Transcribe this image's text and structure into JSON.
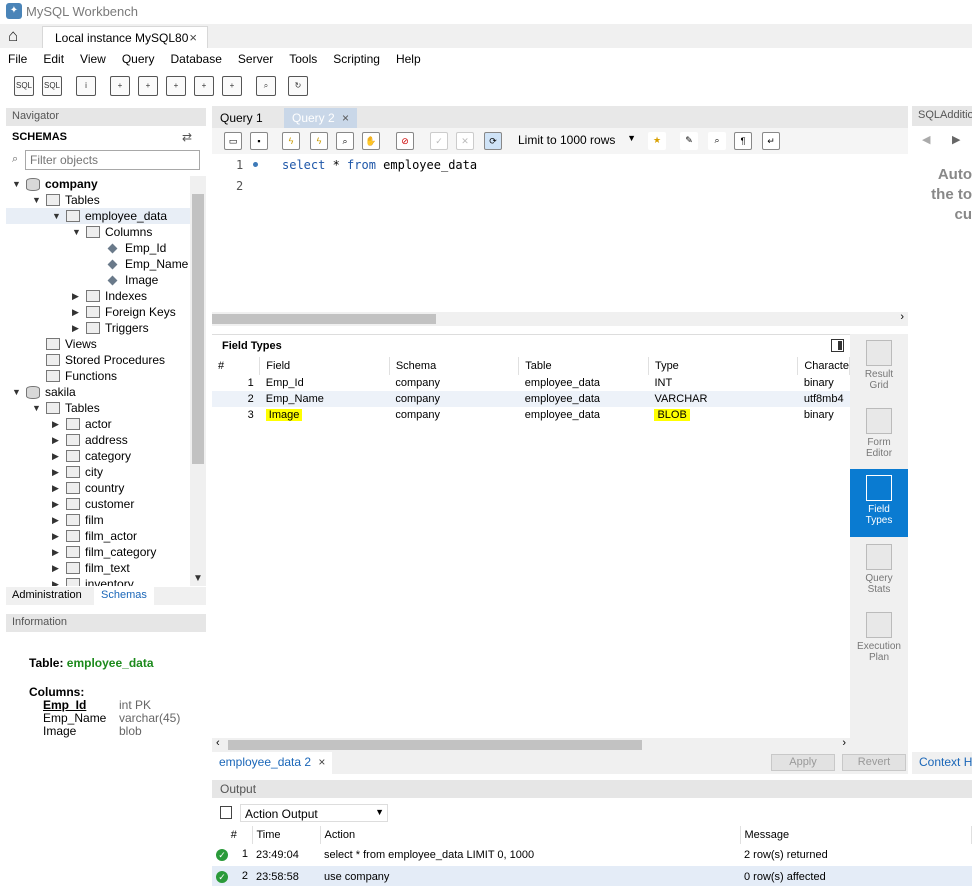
{
  "app": {
    "title": "MySQL Workbench"
  },
  "connection_tab": {
    "label": "Local instance MySQL80",
    "close": "×"
  },
  "menu": [
    "File",
    "Edit",
    "View",
    "Query",
    "Database",
    "Server",
    "Tools",
    "Scripting",
    "Help"
  ],
  "navigator": {
    "header": "Navigator",
    "schemas_label": "SCHEMAS",
    "filter_placeholder": "Filter objects",
    "tree": [
      {
        "label": "company",
        "level": 0,
        "icon": "db",
        "expanded": true,
        "bold": true
      },
      {
        "label": "Tables",
        "level": 1,
        "icon": "folder",
        "expanded": true
      },
      {
        "label": "employee_data",
        "level": 2,
        "icon": "table",
        "expanded": true,
        "selected": true
      },
      {
        "label": "Columns",
        "level": 3,
        "icon": "folder",
        "expanded": true
      },
      {
        "label": "Emp_Id",
        "level": 4,
        "icon": "column"
      },
      {
        "label": "Emp_Name",
        "level": 4,
        "icon": "column"
      },
      {
        "label": "Image",
        "level": 4,
        "icon": "column"
      },
      {
        "label": "Indexes",
        "level": 3,
        "icon": "folder",
        "expanded": false
      },
      {
        "label": "Foreign Keys",
        "level": 3,
        "icon": "folder",
        "expanded": false
      },
      {
        "label": "Triggers",
        "level": 3,
        "icon": "folder",
        "expanded": false
      },
      {
        "label": "Views",
        "level": 1,
        "icon": "folder",
        "leaf": true
      },
      {
        "label": "Stored Procedures",
        "level": 1,
        "icon": "folder",
        "leaf": true
      },
      {
        "label": "Functions",
        "level": 1,
        "icon": "folder",
        "leaf": true
      },
      {
        "label": "sakila",
        "level": 0,
        "icon": "db",
        "expanded": true
      },
      {
        "label": "Tables",
        "level": 1,
        "icon": "folder",
        "expanded": true
      },
      {
        "label": "actor",
        "level": 2,
        "icon": "table",
        "expanded": false
      },
      {
        "label": "address",
        "level": 2,
        "icon": "table",
        "expanded": false
      },
      {
        "label": "category",
        "level": 2,
        "icon": "table",
        "expanded": false
      },
      {
        "label": "city",
        "level": 2,
        "icon": "table",
        "expanded": false
      },
      {
        "label": "country",
        "level": 2,
        "icon": "table",
        "expanded": false
      },
      {
        "label": "customer",
        "level": 2,
        "icon": "table",
        "expanded": false
      },
      {
        "label": "film",
        "level": 2,
        "icon": "table",
        "expanded": false
      },
      {
        "label": "film_actor",
        "level": 2,
        "icon": "table",
        "expanded": false
      },
      {
        "label": "film_category",
        "level": 2,
        "icon": "table",
        "expanded": false
      },
      {
        "label": "film_text",
        "level": 2,
        "icon": "table",
        "expanded": false
      },
      {
        "label": "inventory",
        "level": 2,
        "icon": "table",
        "expanded": false
      }
    ],
    "tabs": {
      "administration": "Administration",
      "schemas": "Schemas"
    }
  },
  "information": {
    "header": "Information",
    "table_label": "Table:",
    "table_name": "employee_data",
    "columns_label": "Columns:",
    "columns": [
      {
        "name": "Emp_Id",
        "type": "int PK",
        "pk": true
      },
      {
        "name": "Emp_Name",
        "type": "varchar(45)"
      },
      {
        "name": "Image",
        "type": "blob"
      }
    ]
  },
  "query_tabs": [
    {
      "label": "Query 1"
    },
    {
      "label": "Query 2",
      "close": "×",
      "active": true
    }
  ],
  "query_toolbar": {
    "limit": "Limit to 1000 rows"
  },
  "editor": {
    "lines": [
      "1",
      "2"
    ],
    "sql_kw1": "select",
    "sql_mid": " * ",
    "sql_kw2": "from",
    "sql_end": " employee_data"
  },
  "field_types": {
    "title": "Field Types",
    "columns": [
      "#",
      "Field",
      "Schema",
      "Table",
      "Type",
      "Characte"
    ],
    "rows": [
      {
        "n": "1",
        "field": "Emp_Id",
        "schema": "company",
        "table": "employee_data",
        "type": "INT",
        "charset": "binary"
      },
      {
        "n": "2",
        "field": "Emp_Name",
        "schema": "company",
        "table": "employee_data",
        "type": "VARCHAR",
        "charset": "utf8mb4"
      },
      {
        "n": "3",
        "field": "Image",
        "schema": "company",
        "table": "employee_data",
        "type": "BLOB",
        "charset": "binary"
      }
    ]
  },
  "result_sidebar": [
    {
      "line1": "Result",
      "line2": "Grid"
    },
    {
      "line1": "Form",
      "line2": "Editor"
    },
    {
      "line1": "Field",
      "line2": "Types",
      "active": true
    },
    {
      "line1": "Query",
      "line2": "Stats"
    },
    {
      "line1": "Execution",
      "line2": "Plan"
    }
  ],
  "result_tab": {
    "label": "employee_data 2",
    "close": "×",
    "apply": "Apply",
    "revert": "Revert"
  },
  "sql_additions": {
    "header": "SQLAdditions",
    "nav_back": "◀",
    "nav_forward": "▶",
    "lines": [
      "Auto",
      "the to",
      "cu"
    ],
    "context_tab": "Context Help"
  },
  "output": {
    "header": "Output",
    "selector": "Action Output",
    "columns": [
      "#",
      "Time",
      "Action",
      "Message"
    ],
    "rows": [
      {
        "n": "1",
        "time": "23:49:04",
        "action": "select * from employee_data LIMIT 0, 1000",
        "message": "2 row(s) returned"
      },
      {
        "n": "2",
        "time": "23:58:58",
        "action": "use company",
        "message": "0 row(s) affected"
      }
    ]
  }
}
